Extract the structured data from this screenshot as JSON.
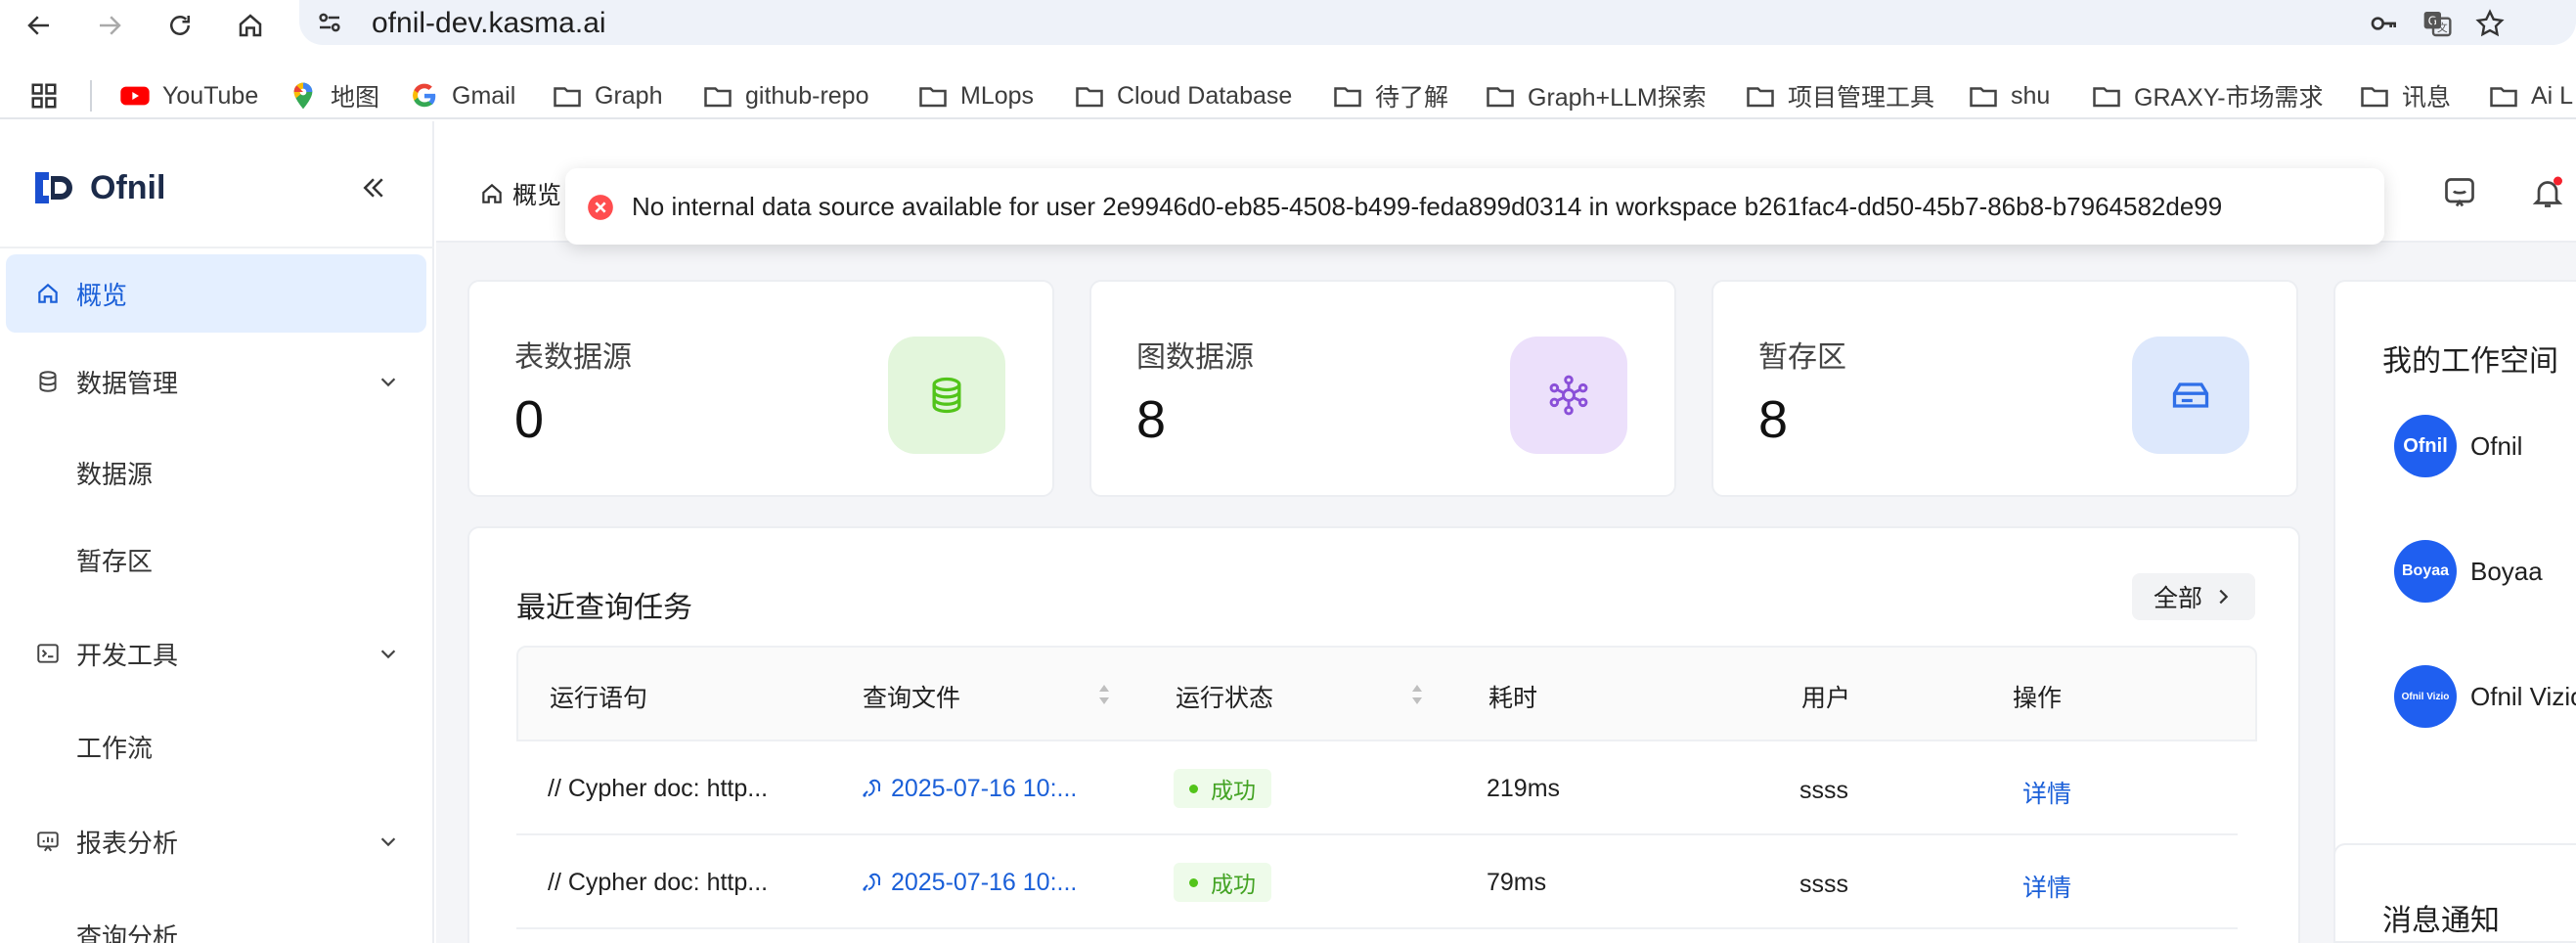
{
  "browser": {
    "url": "ofnil-dev.kasma.ai",
    "bookmarks": [
      {
        "label": "YouTube",
        "icon": "youtube-icon"
      },
      {
        "label": "地图",
        "icon": "maps-icon"
      },
      {
        "label": "Gmail",
        "icon": "google-icon"
      },
      {
        "label": "Graph",
        "icon": "folder-icon"
      },
      {
        "label": "github-repo",
        "icon": "folder-icon"
      },
      {
        "label": "MLops",
        "icon": "folder-icon"
      },
      {
        "label": "Cloud Database",
        "icon": "folder-icon"
      },
      {
        "label": "待了解",
        "icon": "folder-icon"
      },
      {
        "label": "Graph+LLM探索",
        "icon": "folder-icon"
      },
      {
        "label": "项目管理工具",
        "icon": "folder-icon"
      },
      {
        "label": "shu",
        "icon": "folder-icon"
      },
      {
        "label": "GRAXY-市场需求",
        "icon": "folder-icon"
      },
      {
        "label": "讯息",
        "icon": "folder-icon"
      },
      {
        "label": "Ai L",
        "icon": "folder-icon"
      }
    ]
  },
  "brand": {
    "name": "Ofnil",
    "color": "#1c2b4a"
  },
  "sidebar": {
    "items": [
      {
        "label": "概览",
        "icon": "home-icon",
        "active": true
      },
      {
        "label": "数据管理",
        "icon": "database-icon",
        "expandable": true
      },
      {
        "label": "数据源"
      },
      {
        "label": "暂存区"
      },
      {
        "label": "开发工具",
        "icon": "terminal-icon",
        "expandable": true
      },
      {
        "label": "工作流"
      },
      {
        "label": "报表分析",
        "icon": "report-icon",
        "expandable": true
      },
      {
        "label": "查询分析"
      }
    ]
  },
  "header": {
    "breadcrumb": "概览"
  },
  "toast": {
    "type": "error",
    "message": "No internal data source available for user 2e9946d0-eb85-4508-b499-feda899d0314 in workspace b261fac4-dd50-45b7-86b8-b7964582de99"
  },
  "stats": [
    {
      "title": "表数据源",
      "value": "0",
      "icon": "database-stack-icon",
      "bg": "#e3f6dc",
      "fg": "#52c41a"
    },
    {
      "title": "图数据源",
      "value": "8",
      "icon": "graph-network-icon",
      "bg": "#ece0fb",
      "fg": "#8a4fd8"
    },
    {
      "title": "暂存区",
      "value": "8",
      "icon": "storage-drive-icon",
      "bg": "#dde8fc",
      "fg": "#2f6fe8"
    }
  ],
  "tasks": {
    "title": "最近查询任务",
    "all_label": "全部",
    "columns": [
      "运行语句",
      "查询文件",
      "运行状态",
      "耗时",
      "用户",
      "操作"
    ],
    "rows": [
      {
        "statement": "// Cypher doc: http...",
        "file": "2025-07-16 10:...",
        "status": "成功",
        "duration": "219ms",
        "user": "ssss",
        "action": "详情"
      },
      {
        "statement": "// Cypher doc: http...",
        "file": "2025-07-16 10:...",
        "status": "成功",
        "duration": "79ms",
        "user": "ssss",
        "action": "详情"
      }
    ]
  },
  "workspaces": {
    "title": "我的工作空间",
    "items": [
      {
        "avatar": "Ofnil",
        "name": "Ofnil"
      },
      {
        "avatar": "Boyaa",
        "name": "Boyaa"
      },
      {
        "avatar": "Ofnil Vizio",
        "name": "Ofnil Vizio"
      }
    ]
  },
  "notifications": {
    "title": "消息通知"
  }
}
